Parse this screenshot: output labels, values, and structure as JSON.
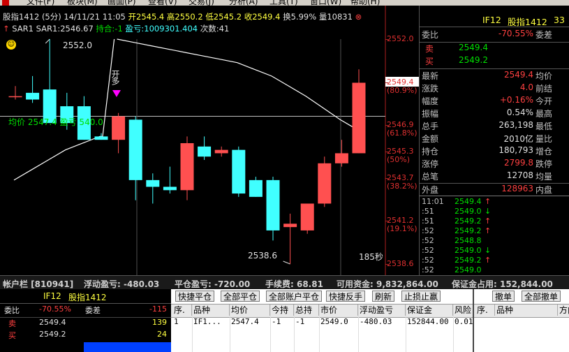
{
  "menu": [
    "文件(F)",
    "板块(M)",
    "画面(P)",
    "查看(V)",
    "交易(J)",
    "分析(A)",
    "工具(T)",
    "窗口(W)",
    "帮助(H)"
  ],
  "chart_header": {
    "symbol": "股指1412",
    "period": "(5分)",
    "datetime": "14/11/21 11:05",
    "open": "开2545.4",
    "high": "高2550.2",
    "low": "低2545.2",
    "close": "收2549.4",
    "turnover": "换5.99%",
    "volume": "量10831"
  },
  "indicator_line": {
    "name": "SAR1",
    "value": "SAR1:2546.67",
    "position": "持合:-1",
    "pnl": "盈亏:1009301.404",
    "count": "次数:41"
  },
  "annotations": {
    "high_marker": "2552.0",
    "low_marker": "2538.6",
    "signal": "开多",
    "avg_line": "均价 2547.4 盈亏 540.0",
    "countdown": "185秒"
  },
  "price_axis": [
    {
      "price": "2552.0",
      "pct": ""
    },
    {
      "price": "2549.4",
      "pct": "(80.9%)"
    },
    {
      "price": "2546.9",
      "pct": "(61.8%)"
    },
    {
      "price": "2545.3",
      "pct": "(50%)"
    },
    {
      "price": "2543.7",
      "pct": "(38.2%)"
    },
    {
      "price": "2541.2",
      "pct": "(19.1%)"
    },
    {
      "price": "2538.6",
      "pct": ""
    }
  ],
  "quote_panel": {
    "code": "IF12",
    "name": "股指1412",
    "num": "33",
    "weibi_label": "委比",
    "weibi_value": "-70.55%",
    "weicha_label": "委差",
    "sell_label": "卖",
    "sell_price": "2549.4",
    "buy_label": "买",
    "buy_price": "2549.2",
    "stats": [
      {
        "l": "最新",
        "v": "2549.4",
        "c": "red",
        "l2": "均价"
      },
      {
        "l": "涨跌",
        "v": "4.0",
        "c": "red",
        "l2": "前结"
      },
      {
        "l": "幅度",
        "v": "+0.16%",
        "c": "red",
        "l2": "今开"
      },
      {
        "l": "振幅",
        "v": "0.54%",
        "c": "white",
        "l2": "最高"
      },
      {
        "l": "总手",
        "v": "263,198",
        "c": "white",
        "l2": "最低"
      },
      {
        "l": "金额",
        "v": "2010亿",
        "c": "white",
        "l2": "量比"
      },
      {
        "l": "持仓",
        "v": "180,793",
        "c": "white",
        "l2": "增仓"
      },
      {
        "l": "涨停",
        "v": "2799.8",
        "c": "red",
        "l2": "跌停"
      },
      {
        "l": "总笔",
        "v": "12708",
        "c": "white",
        "l2": "均量"
      },
      {
        "l": "外盘",
        "v": "128963",
        "c": "red",
        "l2": "内盘"
      }
    ],
    "ticks_time": [
      "11:01",
      ":51",
      ":51",
      ":52",
      ":52",
      ":52",
      ":52",
      ":52"
    ],
    "ticks": [
      {
        "p": "2549.4",
        "a": "↑",
        "ac": "red"
      },
      {
        "p": "2549.0",
        "a": "↓",
        "ac": "green"
      },
      {
        "p": "2549.2",
        "a": "↑",
        "ac": "red"
      },
      {
        "p": "2549.2",
        "a": "↑",
        "ac": "red"
      },
      {
        "p": "2548.8",
        "a": "",
        "ac": "green"
      },
      {
        "p": "2549.0",
        "a": "↓",
        "ac": "green"
      },
      {
        "p": "2549.2",
        "a": "↑",
        "ac": "red"
      },
      {
        "p": "2549.0",
        "a": "",
        "ac": "green"
      }
    ]
  },
  "account_bar": {
    "label": "帐户栏 [810941]",
    "float_pnl": "浮动盈亏: -480.03",
    "close_pnl": "平仓盈亏: -720.00",
    "fee": "手续费: 68.81",
    "cash": "可用资金: 9,832,864.00",
    "margin": "保证金占用: 152,844.00"
  },
  "mini_quote": {
    "code": "IF12",
    "name": "股指1412",
    "weibi_label": "委比",
    "weibi_value": "-70.55%",
    "weicha_label": "委差",
    "weicha_value": "-115",
    "sell_label": "卖",
    "sell_price": "2549.4",
    "sell_vol": "139",
    "buy_label": "买",
    "buy_price": "2549.2",
    "buy_vol": "24"
  },
  "positions": {
    "buttons": [
      "快捷平仓",
      "全部平仓",
      "全部账户平仓",
      "快捷反手",
      "刷新",
      "止损止赢"
    ],
    "headers": [
      "序.",
      "品种",
      "均价",
      "今持",
      "总持",
      "市价",
      "浮动盈亏",
      "保证金",
      "风险"
    ],
    "row": [
      "1",
      "IF1...",
      "2547.4",
      "-1",
      "-1",
      "2549.0",
      "-480.03",
      "152844.00",
      "0.01"
    ]
  },
  "orders": {
    "buttons": [
      "撤单",
      "全部撤单"
    ],
    "headers": [
      "序.",
      "品种",
      "方向"
    ]
  },
  "colors": {
    "up": "#ff5050",
    "down": "#40ffff",
    "text_red": "#ff4040",
    "text_green": "#00e000",
    "sar_line": "#ffffff"
  },
  "chart_data": {
    "type": "candlestick",
    "ylim": [
      2538.2,
      2552.4
    ],
    "candles": [
      {
        "o": 2548.6,
        "h": 2549.2,
        "l": 2548.4,
        "c": 2548.6
      },
      {
        "o": 2548.8,
        "h": 2549.8,
        "l": 2548.2,
        "c": 2548.4
      },
      {
        "o": 2549.0,
        "h": 2552.0,
        "l": 2547.0,
        "c": 2547.0
      },
      {
        "o": 2548.0,
        "h": 2548.8,
        "l": 2546.6,
        "c": 2547.0
      },
      {
        "o": 2548.0,
        "h": 2548.6,
        "l": 2546.0,
        "c": 2546.0
      },
      {
        "o": 2546.2,
        "h": 2546.4,
        "l": 2546.0,
        "c": 2546.0
      },
      {
        "o": 2546.0,
        "h": 2547.6,
        "l": 2545.2,
        "c": 2547.4
      },
      {
        "o": 2547.2,
        "h": 2547.4,
        "l": 2542.4,
        "c": 2543.6
      },
      {
        "o": 2543.6,
        "h": 2544.0,
        "l": 2542.2,
        "c": 2543.2
      },
      {
        "o": 2543.2,
        "h": 2544.4,
        "l": 2542.8,
        "c": 2543.0
      },
      {
        "o": 2543.0,
        "h": 2546.2,
        "l": 2542.4,
        "c": 2545.8
      },
      {
        "o": 2545.6,
        "h": 2546.2,
        "l": 2544.8,
        "c": 2545.0
      },
      {
        "o": 2545.2,
        "h": 2545.6,
        "l": 2545.0,
        "c": 2545.4
      },
      {
        "o": 2545.4,
        "h": 2545.6,
        "l": 2542.6,
        "c": 2542.8
      },
      {
        "o": 2543.6,
        "h": 2543.8,
        "l": 2542.6,
        "c": 2542.6
      },
      {
        "o": 2543.6,
        "h": 2543.8,
        "l": 2540.0,
        "c": 2540.6
      },
      {
        "o": 2540.8,
        "h": 2541.6,
        "l": 2538.6,
        "c": 2541.0
      },
      {
        "o": 2540.6,
        "h": 2542.2,
        "l": 2540.4,
        "c": 2542.2
      },
      {
        "o": 2542.2,
        "h": 2545.0,
        "l": 2542.0,
        "c": 2544.6
      },
      {
        "o": 2544.6,
        "h": 2546.0,
        "l": 2544.4,
        "c": 2545.2
      },
      {
        "o": 2545.2,
        "h": 2550.2,
        "l": 2545.2,
        "c": 2549.4
      }
    ],
    "sar": [
      2543.6,
      2544.2,
      2544.8,
      2545.4,
      2545.8,
      2546.2,
      2552.0,
      2551.8,
      2551.6,
      2551.4,
      2551.2,
      2551.0,
      2550.8,
      2550.6,
      2550.2,
      2549.8,
      2549.2,
      2548.6,
      2547.9,
      2547.2,
      2546.6
    ],
    "avg_price": 2547.4
  }
}
